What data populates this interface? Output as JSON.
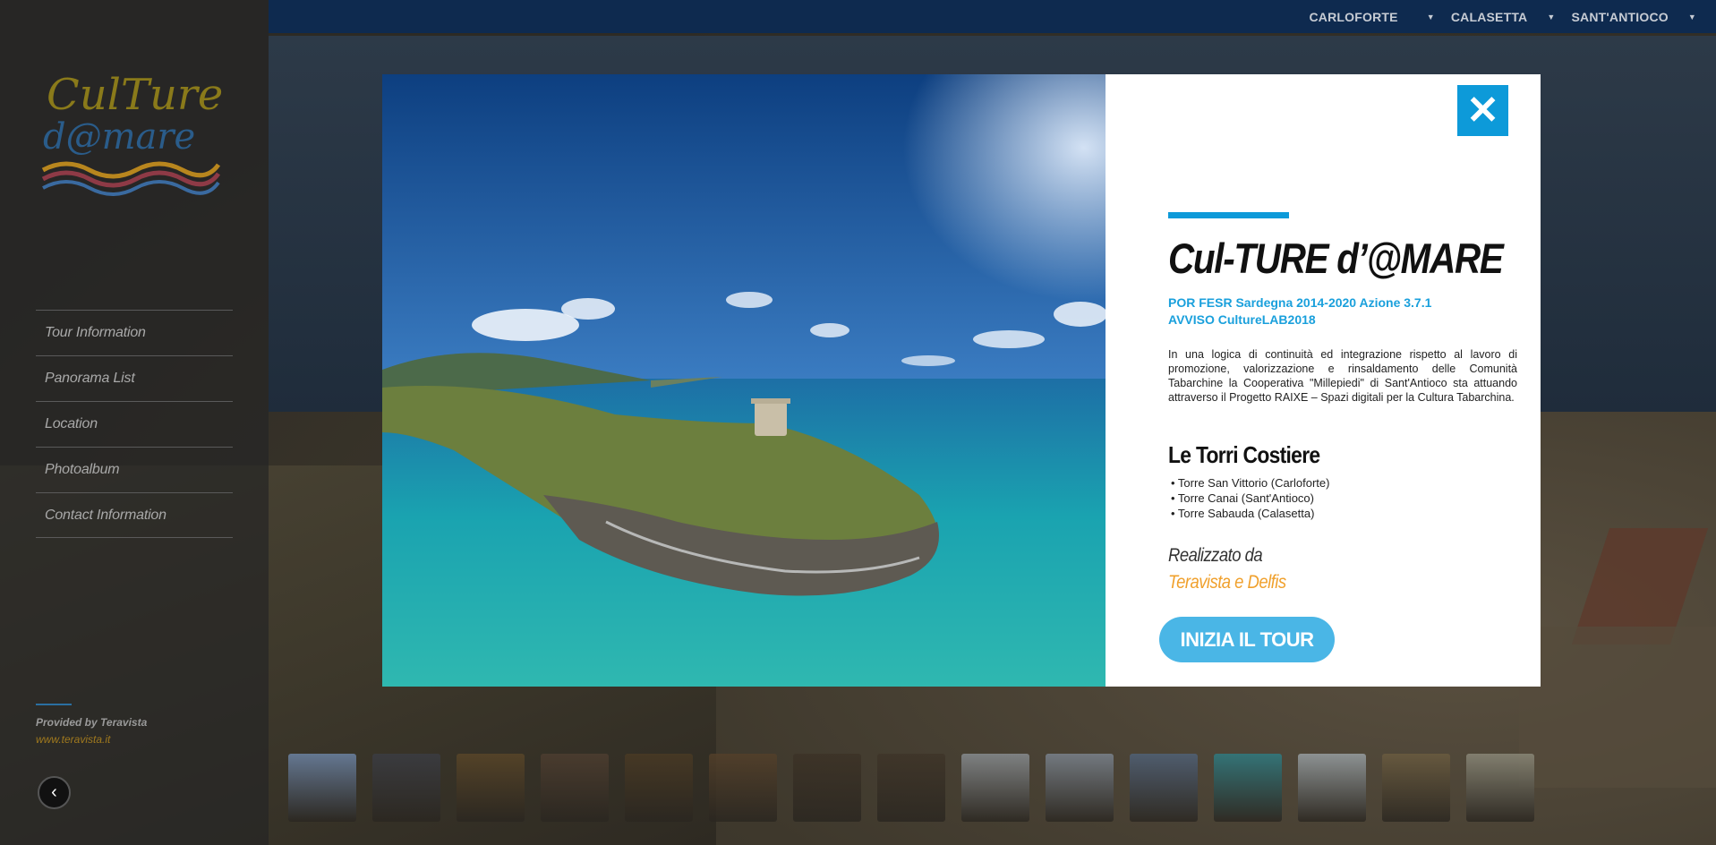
{
  "topbar": {
    "nav": [
      {
        "label": "CARLOFORTE"
      },
      {
        "label": "CALASETTA"
      },
      {
        "label": "SANT'ANTIOCO"
      }
    ]
  },
  "sidebar": {
    "logo_text_top": "CulTure",
    "logo_text_bottom": "d@mare",
    "menu": [
      {
        "label": "Tour Information"
      },
      {
        "label": "Panorama List"
      },
      {
        "label": "Location"
      },
      {
        "label": "Photoalbum"
      },
      {
        "label": "Contact Information"
      }
    ],
    "provided_by": "Provided by Teravista",
    "provided_link": "www.teravista.it",
    "back_icon": "chevron-left-icon"
  },
  "thumbnails": [
    {
      "name": "thumb-1",
      "color": "#6e86a8"
    },
    {
      "name": "thumb-2",
      "color": "#3b3d44"
    },
    {
      "name": "thumb-3",
      "color": "#5a4628"
    },
    {
      "name": "thumb-4",
      "color": "#4e3e30"
    },
    {
      "name": "thumb-5",
      "color": "#4a3a24"
    },
    {
      "name": "thumb-6",
      "color": "#54402a"
    },
    {
      "name": "thumb-7",
      "color": "#3c3226"
    },
    {
      "name": "thumb-8",
      "color": "#3e3428"
    },
    {
      "name": "thumb-9",
      "color": "#8a8f93"
    },
    {
      "name": "thumb-10",
      "color": "#7c8590"
    },
    {
      "name": "thumb-11",
      "color": "#50627a"
    },
    {
      "name": "thumb-12",
      "color": "#2e7d84"
    },
    {
      "name": "thumb-13",
      "color": "#9aa2a6"
    },
    {
      "name": "thumb-14",
      "color": "#6b5c40"
    },
    {
      "name": "thumb-15",
      "color": "#8c8a7a"
    }
  ],
  "modal": {
    "close_icon": "close-icon",
    "title": "Cul-TURE d’@MARE",
    "subtitle": "POR FESR Sardegna 2014-2020 Azione 3.7.1 AVVISO CultureLAB2018",
    "body": "In una logica di continuità ed integrazione rispetto al lavoro di promozione, valorizzazione e rinsaldamento delle Comunità Tabarchine la Cooperativa \"Millepiedi\" di Sant'Antioco sta attuando attraverso il Progetto RAIXE – Spazi digitali per la Cultura Tabarchina.",
    "section_title": "Le Torri Costiere",
    "towers": [
      "• Torre San Vittorio (Carloforte)",
      "• Torre Canai (Sant'Antioco)",
      "• Torre Sabauda (Calasetta)"
    ],
    "made_by_label": "Realizzato da",
    "made_by_names": "Teravista e Delfis",
    "start_button": "INIZIA IL TOUR"
  },
  "colors": {
    "accent": "#0d9ad9",
    "button": "#4ab6e6",
    "authors": "#f0a02c",
    "topbar": "#0e2a4f"
  }
}
